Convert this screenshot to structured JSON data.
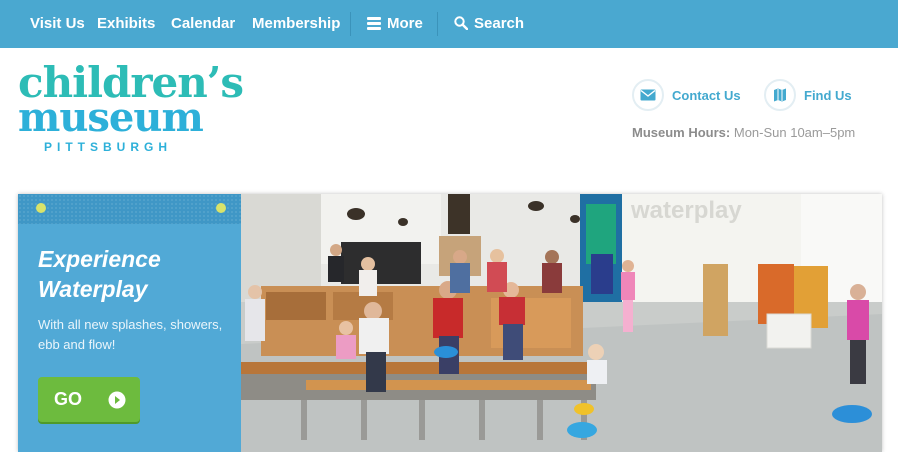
{
  "colors": {
    "nav_bg": "#4aa8d0",
    "logo_teal": "#2dbcb6",
    "logo_blue": "#2db0d9",
    "promo_bg": "#51a9d6",
    "go_green": "#6dbb3e"
  },
  "nav": {
    "items": [
      {
        "label": "Visit Us"
      },
      {
        "label": "Exhibits"
      },
      {
        "label": "Calendar"
      },
      {
        "label": "Membership"
      }
    ],
    "more": {
      "label": "More",
      "icon": "menu-icon"
    },
    "search": {
      "label": "Search",
      "icon": "search-icon"
    }
  },
  "logo": {
    "line1": "children’s",
    "line2": "museum",
    "line3": "PITTSBURGH"
  },
  "header": {
    "contact": {
      "label": "Contact Us",
      "icon": "envelope-icon"
    },
    "find": {
      "label": "Find Us",
      "icon": "map-icon"
    },
    "hours_label": "Museum Hours:",
    "hours_value": "Mon-Sun 10am–5pm"
  },
  "hero": {
    "title_line1": "Experience",
    "title_line2": "Waterplay",
    "text": "With all new splashes, showers, ebb and flow!",
    "button_label": "GO",
    "photo_sign": "waterplay"
  }
}
